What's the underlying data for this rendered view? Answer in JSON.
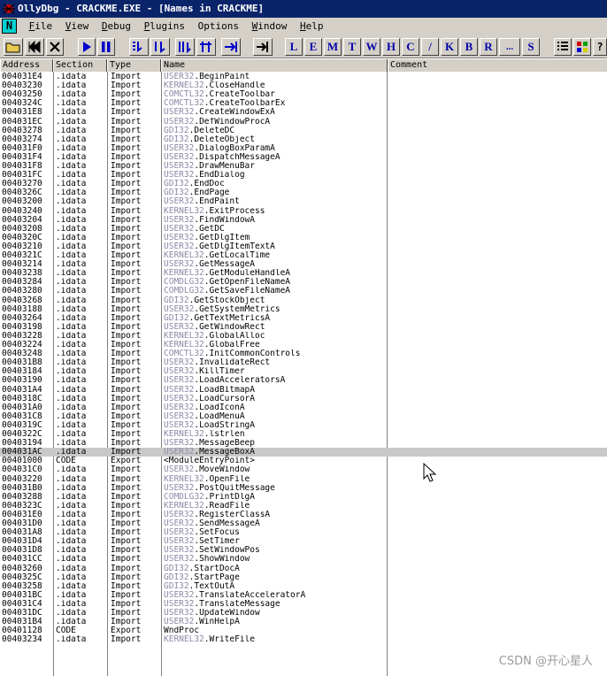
{
  "window": {
    "title": "OllyDbg - CRACKME.EXE - [Names in CRACKME]"
  },
  "menu": {
    "n_icon_label": "N",
    "items": [
      {
        "acc": "F",
        "rest": "ile"
      },
      {
        "acc": "V",
        "rest": "iew"
      },
      {
        "acc": "D",
        "rest": "ebug"
      },
      {
        "acc": "P",
        "rest": "lugins"
      },
      {
        "acc": "",
        "rest": "Options"
      },
      {
        "acc": "W",
        "rest": "indow"
      },
      {
        "acc": "H",
        "rest": "elp"
      }
    ]
  },
  "toolbar": {
    "letters": [
      "L",
      "E",
      "M",
      "T",
      "W",
      "H",
      "C",
      "/",
      "K",
      "B",
      "R",
      "...",
      "S"
    ]
  },
  "columns": {
    "address": "Address",
    "section": "Section",
    "type": "Type",
    "name": "Name",
    "comment": "Comment"
  },
  "rows": [
    {
      "addr": "004031E4",
      "sec": ".idata",
      "type": "Import",
      "dll": "USER32",
      "fn": "BeginPaint"
    },
    {
      "addr": "00403230",
      "sec": ".idata",
      "type": "Import",
      "dll": "KERNEL32",
      "fn": "CloseHandle"
    },
    {
      "addr": "00403250",
      "sec": ".idata",
      "type": "Import",
      "dll": "COMCTL32",
      "fn": "CreateToolbar"
    },
    {
      "addr": "0040324C",
      "sec": ".idata",
      "type": "Import",
      "dll": "COMCTL32",
      "fn": "CreateToolbarEx"
    },
    {
      "addr": "004031E8",
      "sec": ".idata",
      "type": "Import",
      "dll": "USER32",
      "fn": "CreateWindowExA"
    },
    {
      "addr": "004031EC",
      "sec": ".idata",
      "type": "Import",
      "dll": "USER32",
      "fn": "DefWindowProcA"
    },
    {
      "addr": "00403278",
      "sec": ".idata",
      "type": "Import",
      "dll": "GDI32",
      "fn": "DeleteDC"
    },
    {
      "addr": "00403274",
      "sec": ".idata",
      "type": "Import",
      "dll": "GDI32",
      "fn": "DeleteObject"
    },
    {
      "addr": "004031F0",
      "sec": ".idata",
      "type": "Import",
      "dll": "USER32",
      "fn": "DialogBoxParamA"
    },
    {
      "addr": "004031F4",
      "sec": ".idata",
      "type": "Import",
      "dll": "USER32",
      "fn": "DispatchMessageA"
    },
    {
      "addr": "004031F8",
      "sec": ".idata",
      "type": "Import",
      "dll": "USER32",
      "fn": "DrawMenuBar"
    },
    {
      "addr": "004031FC",
      "sec": ".idata",
      "type": "Import",
      "dll": "USER32",
      "fn": "EndDialog"
    },
    {
      "addr": "00403270",
      "sec": ".idata",
      "type": "Import",
      "dll": "GDI32",
      "fn": "EndDoc"
    },
    {
      "addr": "0040326C",
      "sec": ".idata",
      "type": "Import",
      "dll": "GDI32",
      "fn": "EndPage"
    },
    {
      "addr": "00403200",
      "sec": ".idata",
      "type": "Import",
      "dll": "USER32",
      "fn": "EndPaint"
    },
    {
      "addr": "00403240",
      "sec": ".idata",
      "type": "Import",
      "dll": "KERNEL32",
      "fn": "ExitProcess"
    },
    {
      "addr": "00403204",
      "sec": ".idata",
      "type": "Import",
      "dll": "USER32",
      "fn": "FindWindowA"
    },
    {
      "addr": "00403208",
      "sec": ".idata",
      "type": "Import",
      "dll": "USER32",
      "fn": "GetDC"
    },
    {
      "addr": "0040320C",
      "sec": ".idata",
      "type": "Import",
      "dll": "USER32",
      "fn": "GetDlgItem"
    },
    {
      "addr": "00403210",
      "sec": ".idata",
      "type": "Import",
      "dll": "USER32",
      "fn": "GetDlgItemTextA"
    },
    {
      "addr": "0040321C",
      "sec": ".idata",
      "type": "Import",
      "dll": "KERNEL32",
      "fn": "GetLocalTime"
    },
    {
      "addr": "00403214",
      "sec": ".idata",
      "type": "Import",
      "dll": "USER32",
      "fn": "GetMessageA"
    },
    {
      "addr": "00403238",
      "sec": ".idata",
      "type": "Import",
      "dll": "KERNEL32",
      "fn": "GetModuleHandleA"
    },
    {
      "addr": "00403284",
      "sec": ".idata",
      "type": "Import",
      "dll": "COMDLG32",
      "fn": "GetOpenFileNameA"
    },
    {
      "addr": "00403280",
      "sec": ".idata",
      "type": "Import",
      "dll": "COMDLG32",
      "fn": "GetSaveFileNameA"
    },
    {
      "addr": "00403268",
      "sec": ".idata",
      "type": "Import",
      "dll": "GDI32",
      "fn": "GetStockObject"
    },
    {
      "addr": "00403188",
      "sec": ".idata",
      "type": "Import",
      "dll": "USER32",
      "fn": "GetSystemMetrics"
    },
    {
      "addr": "00403264",
      "sec": ".idata",
      "type": "Import",
      "dll": "GDI32",
      "fn": "GetTextMetricsA"
    },
    {
      "addr": "00403198",
      "sec": ".idata",
      "type": "Import",
      "dll": "USER32",
      "fn": "GetWindowRect"
    },
    {
      "addr": "00403228",
      "sec": ".idata",
      "type": "Import",
      "dll": "KERNEL32",
      "fn": "GlobalAlloc"
    },
    {
      "addr": "00403224",
      "sec": ".idata",
      "type": "Import",
      "dll": "KERNEL32",
      "fn": "GlobalFree"
    },
    {
      "addr": "00403248",
      "sec": ".idata",
      "type": "Import",
      "dll": "COMCTL32",
      "fn": "InitCommonControls"
    },
    {
      "addr": "004031B8",
      "sec": ".idata",
      "type": "Import",
      "dll": "USER32",
      "fn": "InvalidateRect"
    },
    {
      "addr": "00403184",
      "sec": ".idata",
      "type": "Import",
      "dll": "USER32",
      "fn": "KillTimer"
    },
    {
      "addr": "00403190",
      "sec": ".idata",
      "type": "Import",
      "dll": "USER32",
      "fn": "LoadAcceleratorsA"
    },
    {
      "addr": "004031A4",
      "sec": ".idata",
      "type": "Import",
      "dll": "USER32",
      "fn": "LoadBitmapA"
    },
    {
      "addr": "0040318C",
      "sec": ".idata",
      "type": "Import",
      "dll": "USER32",
      "fn": "LoadCursorA"
    },
    {
      "addr": "004031A0",
      "sec": ".idata",
      "type": "Import",
      "dll": "USER32",
      "fn": "LoadIconA"
    },
    {
      "addr": "004031C8",
      "sec": ".idata",
      "type": "Import",
      "dll": "USER32",
      "fn": "LoadMenuA"
    },
    {
      "addr": "0040319C",
      "sec": ".idata",
      "type": "Import",
      "dll": "USER32",
      "fn": "LoadStringA"
    },
    {
      "addr": "0040322C",
      "sec": ".idata",
      "type": "Import",
      "dll": "KERNEL32",
      "fn": "lstrlen"
    },
    {
      "addr": "00403194",
      "sec": ".idata",
      "type": "Import",
      "dll": "USER32",
      "fn": "MessageBeep"
    },
    {
      "addr": "004031AC",
      "sec": ".idata",
      "type": "Import",
      "dll": "USER32",
      "fn": "MessageBoxA",
      "selected": true
    },
    {
      "addr": "00401000",
      "sec": "CODE",
      "type": "Export",
      "dll": "",
      "fn": "<ModuleEntryPoint>"
    },
    {
      "addr": "004031C0",
      "sec": ".idata",
      "type": "Import",
      "dll": "USER32",
      "fn": "MoveWindow"
    },
    {
      "addr": "00403220",
      "sec": ".idata",
      "type": "Import",
      "dll": "KERNEL32",
      "fn": "OpenFile"
    },
    {
      "addr": "004031B0",
      "sec": ".idata",
      "type": "Import",
      "dll": "USER32",
      "fn": "PostQuitMessage"
    },
    {
      "addr": "00403288",
      "sec": ".idata",
      "type": "Import",
      "dll": "COMDLG32",
      "fn": "PrintDlgA"
    },
    {
      "addr": "0040323C",
      "sec": ".idata",
      "type": "Import",
      "dll": "KERNEL32",
      "fn": "ReadFile"
    },
    {
      "addr": "004031E0",
      "sec": ".idata",
      "type": "Import",
      "dll": "USER32",
      "fn": "RegisterClassA"
    },
    {
      "addr": "004031D0",
      "sec": ".idata",
      "type": "Import",
      "dll": "USER32",
      "fn": "SendMessageA"
    },
    {
      "addr": "004031A8",
      "sec": ".idata",
      "type": "Import",
      "dll": "USER32",
      "fn": "SetFocus"
    },
    {
      "addr": "004031D4",
      "sec": ".idata",
      "type": "Import",
      "dll": "USER32",
      "fn": "SetTimer"
    },
    {
      "addr": "004031D8",
      "sec": ".idata",
      "type": "Import",
      "dll": "USER32",
      "fn": "SetWindowPos"
    },
    {
      "addr": "004031CC",
      "sec": ".idata",
      "type": "Import",
      "dll": "USER32",
      "fn": "ShowWindow"
    },
    {
      "addr": "00403260",
      "sec": ".idata",
      "type": "Import",
      "dll": "GDI32",
      "fn": "StartDocA"
    },
    {
      "addr": "0040325C",
      "sec": ".idata",
      "type": "Import",
      "dll": "GDI32",
      "fn": "StartPage"
    },
    {
      "addr": "00403258",
      "sec": ".idata",
      "type": "Import",
      "dll": "GDI32",
      "fn": "TextOutA"
    },
    {
      "addr": "004031BC",
      "sec": ".idata",
      "type": "Import",
      "dll": "USER32",
      "fn": "TranslateAcceleratorA"
    },
    {
      "addr": "004031C4",
      "sec": ".idata",
      "type": "Import",
      "dll": "USER32",
      "fn": "TranslateMessage"
    },
    {
      "addr": "004031DC",
      "sec": ".idata",
      "type": "Import",
      "dll": "USER32",
      "fn": "UpdateWindow"
    },
    {
      "addr": "004031B4",
      "sec": ".idata",
      "type": "Import",
      "dll": "USER32",
      "fn": "WinHelpA"
    },
    {
      "addr": "00401128",
      "sec": "CODE",
      "type": "Export",
      "dll": "",
      "fn": "WndProc"
    },
    {
      "addr": "00403234",
      "sec": ".idata",
      "type": "Import",
      "dll": "KERNEL32",
      "fn": "WriteFile"
    }
  ],
  "watermark": "CSDN @开心星人",
  "colors": {
    "titlebar": "#0a246a",
    "dll_prefix": "#8a8aa8",
    "selected_row": "#c8c8c8",
    "toolbar_letter": "#0000a8"
  }
}
